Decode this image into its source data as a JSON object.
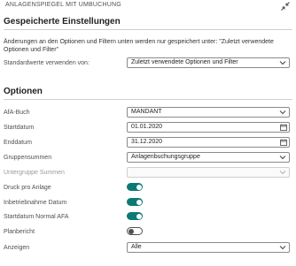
{
  "header": {
    "title": "ANLAGENSPIEGEL MIT UMBUCHUNG",
    "collapse_icon": "collapse-diagonal-icon"
  },
  "saved_settings": {
    "title": "Gespeicherte Einstellungen",
    "info": "Änderungen an den Optionen und Filtern unten werden nur gespeichert unter: \"Zuletzt verwendete Optionen und Filter\"",
    "default_label": "Standardwerte verwenden von:",
    "default_value": "Zuletzt verwendete Optionen und Filter"
  },
  "options": {
    "title": "Optionen",
    "afa_buch_label": "AfA-Buch",
    "afa_buch_value": "MANDANT",
    "startdatum_label": "Startdatum",
    "startdatum_value": "01.01.2020",
    "enddatum_label": "Enddatum",
    "enddatum_value": "31.12.2020",
    "gruppensummen_label": "Gruppensummen",
    "gruppensummen_value": "Anlagenbuchungsgruppe",
    "untergruppe_label": "Untergruppe Summen",
    "untergruppe_value": "",
    "druck_label": "Druck pro Anlage",
    "druck_on": true,
    "inbetrieb_label": "Inbetriebnahme Datum",
    "inbetrieb_on": true,
    "normal_afa_label": "Startdatum Normal AFA",
    "normal_afa_on": true,
    "planbericht_label": "Planbericht",
    "planbericht_on": false,
    "anzeigen_label": "Anzeigen",
    "anzeigen_value": "Alle"
  },
  "colors": {
    "accent": "#0b7a75",
    "border": "#8a8a8a",
    "label": "#505050"
  }
}
